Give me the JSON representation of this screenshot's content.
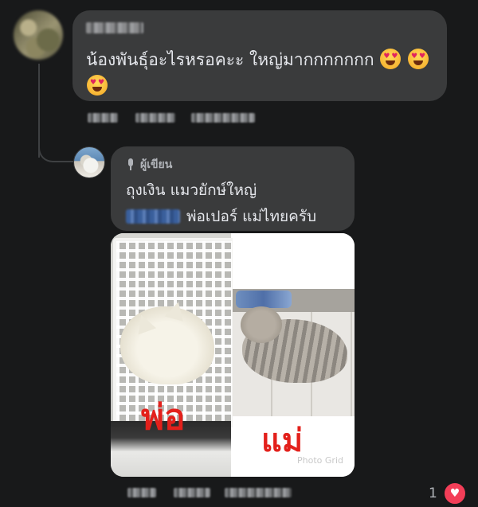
{
  "comments": [
    {
      "author": "",
      "text": "น้องพันธุ์อะไรหรอคะะ ใหญ่มากกกกกกก",
      "emoji_name": "heart-eyes-emoji",
      "emoji_count": 3
    }
  ],
  "reply": {
    "badge": "ผู้เขียน",
    "line1": "ถุงเงิน แมวยักษ์ใหญ่",
    "line2": "พ่อเปอร์ แม่ไทยครับ",
    "photo": {
      "label_left": "พ่อ",
      "label_right": "แม่",
      "watermark": "Photo Grid"
    }
  },
  "reactions": {
    "count": "1",
    "icon": "heart-icon"
  },
  "colors": {
    "background": "#18191a",
    "bubble": "#3a3b3c",
    "text": "#e4e6eb",
    "muted": "#b0b3b8",
    "label_red": "#e3201b",
    "heart": "#f33e58"
  }
}
